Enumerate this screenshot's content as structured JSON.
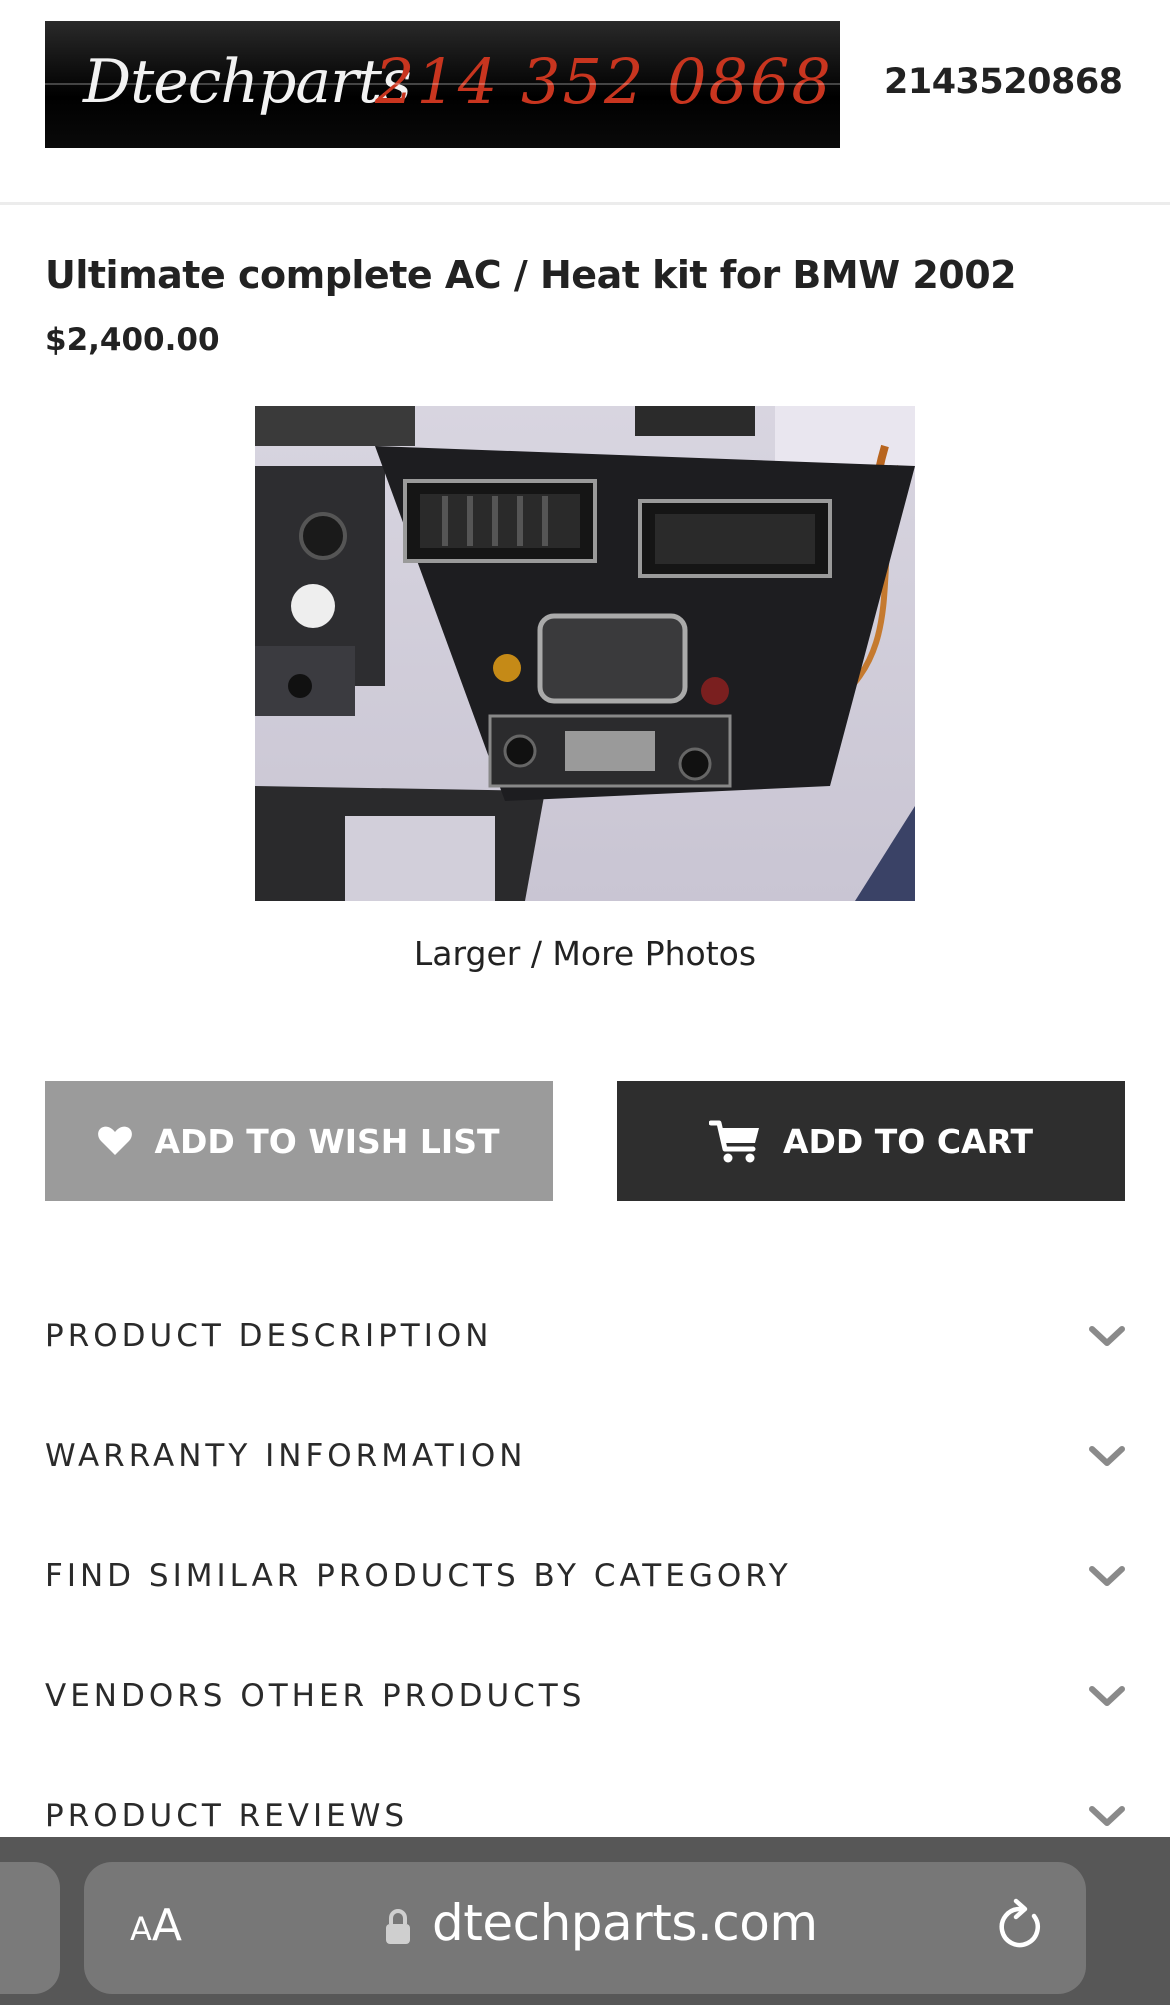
{
  "header": {
    "logo_name": "Dtechparts",
    "logo_phone": "214 352 0868",
    "phone": "2143520868"
  },
  "product": {
    "title": "Ultimate complete AC / Heat kit for BMW 2002",
    "price": "$2,400.00",
    "photo_link": "Larger / More Photos"
  },
  "actions": {
    "wish_label": "ADD TO WISH LIST",
    "cart_label": "ADD TO CART"
  },
  "sections": [
    {
      "label": "PRODUCT DESCRIPTION"
    },
    {
      "label": "WARRANTY INFORMATION"
    },
    {
      "label": "FIND SIMILAR PRODUCTS BY CATEGORY"
    },
    {
      "label": "VENDORS OTHER PRODUCTS"
    },
    {
      "label": "PRODUCT REVIEWS"
    }
  ],
  "browser": {
    "text_size_small": "A",
    "text_size_big": "A",
    "url": "dtechparts.com"
  },
  "icons": {
    "wish": "heart-icon",
    "cart": "cart-icon",
    "accordion": "chevron-down-icon",
    "secure": "lock-icon",
    "refresh": "reload-icon"
  }
}
